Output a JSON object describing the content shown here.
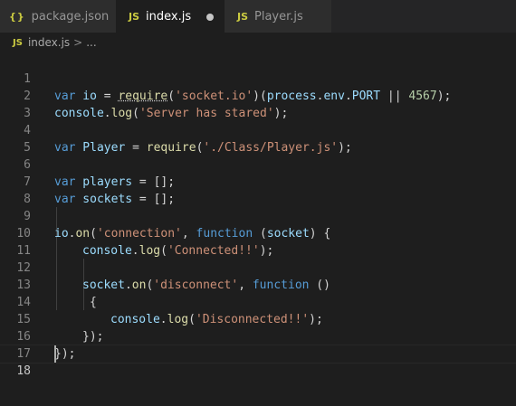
{
  "tabs": [
    {
      "icon": "{}",
      "label": "package.json"
    },
    {
      "icon": "JS",
      "label": "index.js"
    },
    {
      "icon": "JS",
      "label": "Player.js"
    }
  ],
  "breadcrumb": {
    "icon": "JS",
    "file": "index.js",
    "separator": ">",
    "rest": "..."
  },
  "line_numbers": [
    "1",
    "2",
    "3",
    "4",
    "5",
    "6",
    "7",
    "8",
    "9",
    "10",
    "11",
    "12",
    "13",
    "14",
    "15",
    "16",
    "17",
    "18"
  ],
  "code": {
    "l1": {
      "kw": "var",
      "var": " io",
      "op": " = ",
      "fn": "require",
      "p1": "(",
      "str": "'socket.io'",
      "p2": ")(",
      "v2": "process",
      "d1": ".",
      "v3": "env",
      "d2": ".",
      "v4": "PORT",
      "op2": " || ",
      "num": "4567",
      "end": ");"
    },
    "l2": {
      "v": "console",
      "d": ".",
      "fn": "log",
      "p": "(",
      "str": "'Server has stared'",
      "end": ");"
    },
    "l4": {
      "kw": "var",
      "var": " Player",
      "op": " = ",
      "fn": "require",
      "p": "(",
      "str": "'./Class/Player.js'",
      "end": ");"
    },
    "l6": {
      "kw": "var",
      "var": " players",
      "rest": " = [];"
    },
    "l7": {
      "kw": "var",
      "var": " sockets",
      "rest": " = [];"
    },
    "l9": {
      "v": "io",
      "d": ".",
      "fn": "on",
      "p": "(",
      "str": "'connection'",
      "c": ", ",
      "kw": "function",
      "p2": " (",
      "arg": "socket",
      "end": ") {"
    },
    "l10": {
      "v": "console",
      "d": ".",
      "fn": "log",
      "p": "(",
      "str": "'Connected!!'",
      "end": ");"
    },
    "l12": {
      "v": "socket",
      "d": ".",
      "fn": "on",
      "p": "(",
      "str": "'disconnect'",
      "c": ", ",
      "kw": "function",
      "end": " ()"
    },
    "l13": "{",
    "l14": {
      "v": "console",
      "d": ".",
      "fn": "log",
      "p": "(",
      "str": "'Disconnected!!'",
      "end": ");"
    },
    "l15": "});",
    "l16": "});"
  },
  "colors": {
    "keyword": "#569cd6",
    "string": "#ce9178",
    "function": "#dcdcaa",
    "variable": "#9cdcfe",
    "number": "#b5cea8",
    "background": "#1e1e1e"
  }
}
